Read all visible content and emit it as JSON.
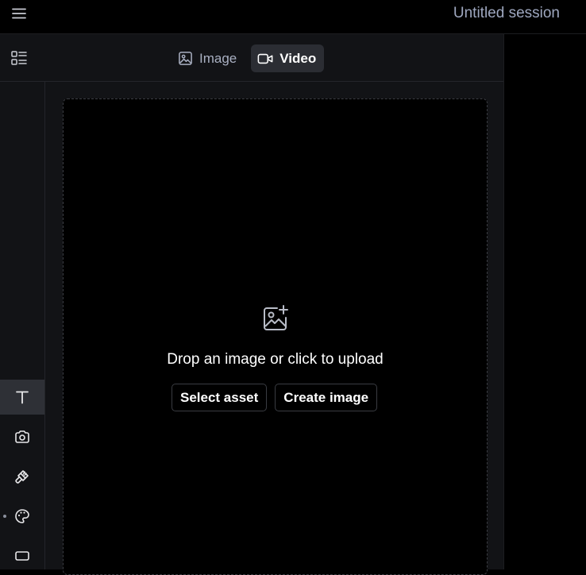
{
  "header": {
    "session_title": "Untitled session"
  },
  "mode_tabs": [
    {
      "label": "Image",
      "icon": "image-icon",
      "active": false
    },
    {
      "label": "Video",
      "icon": "video-icon",
      "active": true
    }
  ],
  "tools": [
    {
      "name": "text-tool",
      "icon": "text-icon",
      "active": true
    },
    {
      "name": "camera-tool",
      "icon": "camera-icon",
      "active": false
    },
    {
      "name": "brush-tool",
      "icon": "brush-icon",
      "active": false
    },
    {
      "name": "palette-tool",
      "icon": "palette-icon",
      "active": false
    },
    {
      "name": "aspect-ratio-tool",
      "icon": "rectangle-icon",
      "active": false
    }
  ],
  "dropzone": {
    "icon": "image-plus-icon",
    "prompt": "Drop an image or click to upload",
    "select_asset_label": "Select asset",
    "create_image_label": "Create image"
  },
  "colors": {
    "background": "#000000",
    "panel": "#121316",
    "active_tab": "#2b2d33",
    "muted_text": "#9ea7bf"
  }
}
